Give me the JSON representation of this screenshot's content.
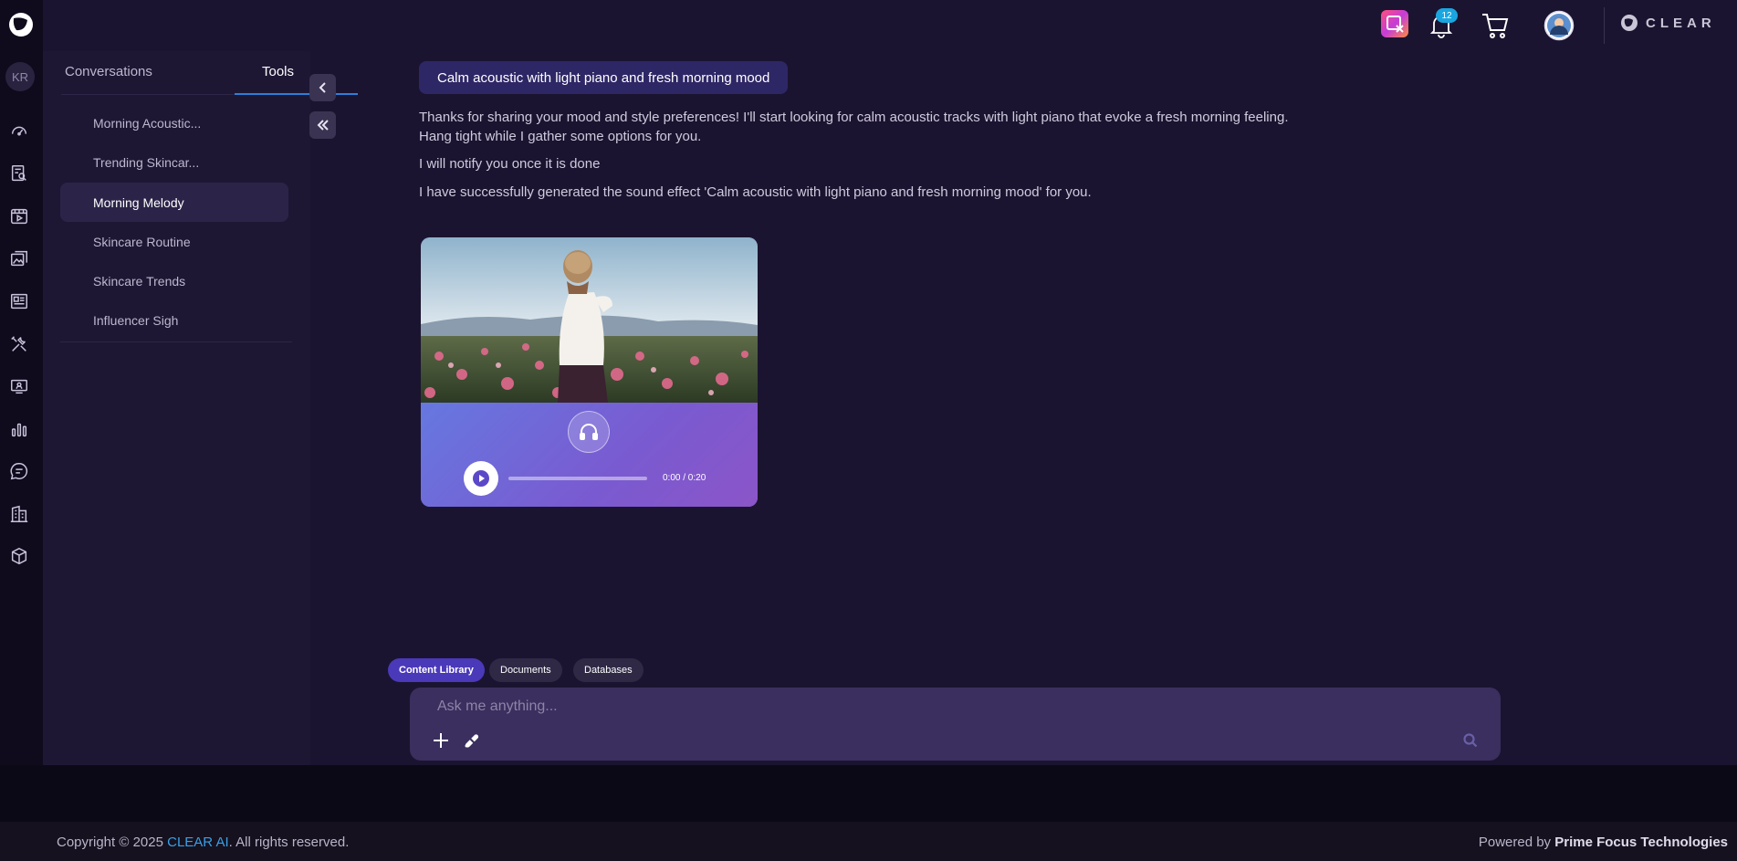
{
  "rail": {
    "avatar_initials": "KR",
    "items": [
      {
        "icon": "gauge-icon"
      },
      {
        "icon": "document-search-icon"
      },
      {
        "icon": "video-icon"
      },
      {
        "icon": "gallery-icon"
      },
      {
        "icon": "newspaper-icon"
      },
      {
        "icon": "tools-icon"
      },
      {
        "icon": "support-icon"
      },
      {
        "icon": "analytics-icon"
      },
      {
        "icon": "chat-icon"
      },
      {
        "icon": "building-icon"
      },
      {
        "icon": "package-icon"
      }
    ]
  },
  "topbar": {
    "notification_count": "12",
    "brand_name": "CLEAR"
  },
  "sidebar": {
    "tabs": [
      {
        "label": "Conversations"
      },
      {
        "label": "Tools"
      }
    ],
    "active_tab": "Tools",
    "threads": [
      {
        "label": "Morning Acoustic..."
      },
      {
        "label": "Trending Skincar..."
      },
      {
        "label": "Morning Melody"
      },
      {
        "label": "Skincare Routine"
      },
      {
        "label": "Skincare Trends"
      },
      {
        "label": "Influencer Sigh"
      }
    ],
    "active_thread": "Morning Melody"
  },
  "chat": {
    "user_message": "Calm acoustic with light piano and fresh morning mood",
    "assistant_lines": [
      "Thanks for sharing your mood and style preferences! I'll start looking for calm acoustic tracks with light piano that evoke a fresh morning feeling.",
      "Hang tight while I gather some options for you.",
      "I will notify you once it is done",
      "I have successfully generated the sound effect 'Calm acoustic with light piano and fresh morning mood' for you."
    ],
    "audio": {
      "time": "0:00 / 0:20",
      "progress": 0
    }
  },
  "context_chips": [
    {
      "label": "Content Library"
    },
    {
      "label": "Documents"
    },
    {
      "label": "Databases"
    }
  ],
  "input": {
    "placeholder": "Ask me anything..."
  },
  "footer": {
    "copyright_prefix": "Copyright © 2025 ",
    "copyright_brand": "CLEAR AI",
    "copyright_suffix": ". All rights reserved.",
    "powered_prefix": "Powered by ",
    "powered_brand": "Prime Focus Technologies"
  },
  "colors": {
    "background": "#1b1430",
    "accent_blue": "#2f7fd6",
    "chip_active": "#4a39b8",
    "badge": "#1aa6e0"
  }
}
